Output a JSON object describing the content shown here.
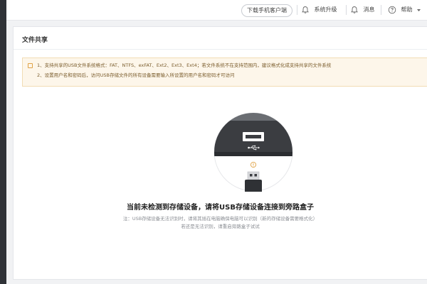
{
  "topbar": {
    "download_client": "下载手机客户端",
    "upgrade": "系统升级",
    "messages": "消息",
    "help": "帮助"
  },
  "icons": {
    "upgrade": "bell-alert-icon",
    "messages": "bell-icon",
    "help": "help-circle-icon",
    "help_caret": "caret-down-icon",
    "usb_symbol": "usb-icon",
    "warning": "info-circle-icon"
  },
  "card": {
    "title": "文件共享",
    "notice": [
      "1、支持共享的USB文件系统格式：FAT、NTFS、exFAT、Ext2、Ext3、Ext4；若文件系统不在支持范围内，建议格式化成支持共享的文件系统",
      "2、设置用户名和密码后，访问USB存储文件的所有设备需要输入所设置的用户名和密码才可访问"
    ],
    "empty_state": {
      "message": "当前未检测到存储设备，请将USB存储设备连接到旁路盒子",
      "hint_line1": "注：USB存储设备无法识别时，请将其插在电脑确保电脑可以识别（新的存储设备需要格式化）",
      "hint_line2": "若还是无法识别，请重启旁路盒子试试"
    }
  },
  "colors": {
    "notice_bg": "#fdf6ea",
    "notice_border": "#f2dcb4",
    "accent_orange": "#e0a244",
    "sidebar_dark": "#2f3237"
  }
}
